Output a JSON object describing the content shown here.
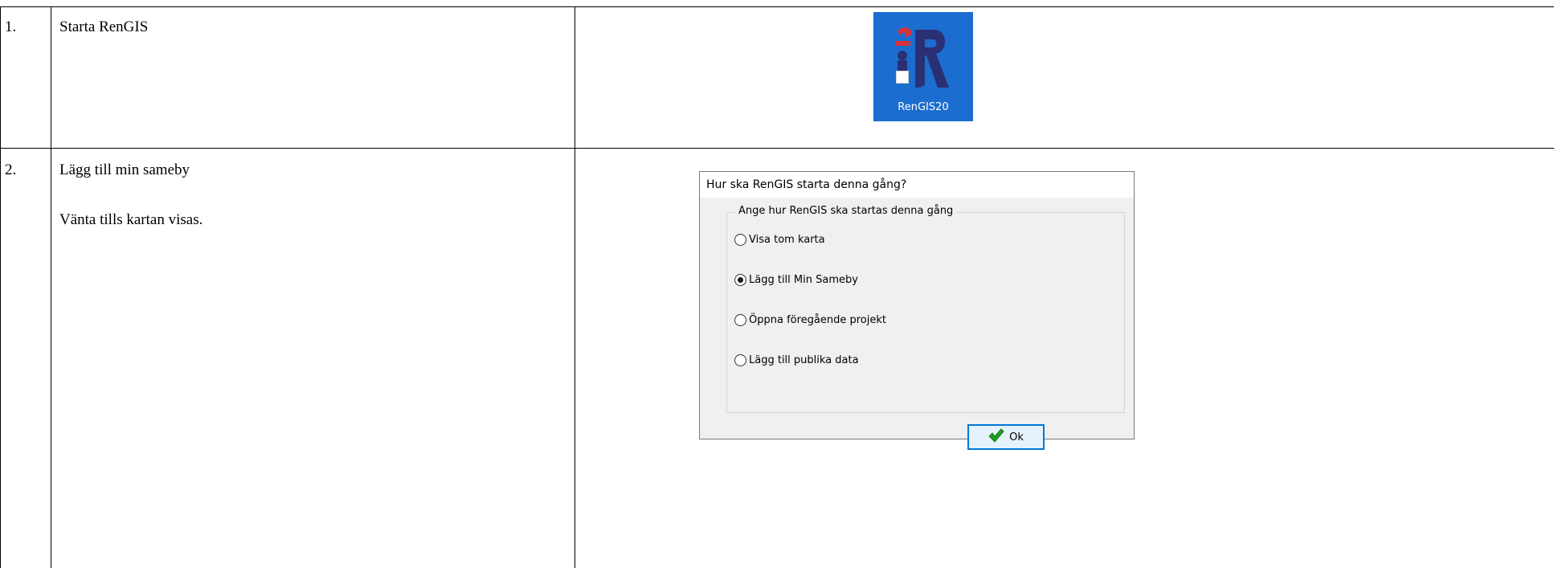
{
  "rows": [
    {
      "number": "1.",
      "lines": [
        "Starta RenGIS"
      ]
    },
    {
      "number": "2.",
      "lines": [
        "Lägg till min sameby",
        "Vänta tills kartan visas."
      ]
    }
  ],
  "app_icon": {
    "label": "RenGIS20",
    "icon": "rengis-app-icon",
    "background": "#1b6dcf"
  },
  "dialog": {
    "title": "Hur ska RenGIS starta denna gång?",
    "group_label": "Ange hur RenGIS ska startas denna gång",
    "options": [
      {
        "label": "Visa tom karta",
        "checked": false
      },
      {
        "label": "Lägg till Min Sameby",
        "checked": true
      },
      {
        "label": "Öppna föregående projekt",
        "checked": false
      },
      {
        "label": "Lägg till publika data",
        "checked": false
      }
    ],
    "ok_label": "Ok",
    "ok_icon": "green-checkmark-icon",
    "ok_border_color": "#0078d7"
  }
}
